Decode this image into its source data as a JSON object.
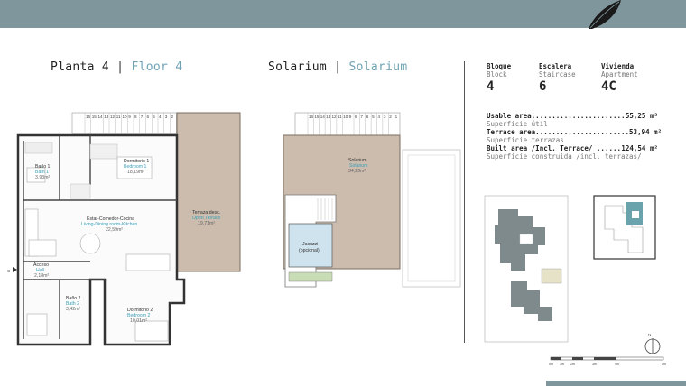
{
  "titles": {
    "left_es": "Planta 4",
    "left_en": "Floor 4",
    "right_es": "Solarium",
    "right_en": "Solarium",
    "sep": "|"
  },
  "info": {
    "bloque": {
      "label": "Bloque",
      "sub": "Block",
      "value": "4"
    },
    "escalera": {
      "label": "Escalera",
      "sub": "Staircase",
      "value": "6"
    },
    "vivienda": {
      "label": "Vivienda",
      "sub": "Apartment",
      "value": "4C"
    }
  },
  "areas": {
    "usable_label": "Usable area.......................",
    "usable_value": "55,25 m²",
    "usable_sub": "Superficie útil",
    "terrace_label": "Terrace area.......................",
    "terrace_value": "53,94 m²",
    "terrace_sub": "Superficie terrazas",
    "built_label": "Built area /Incl. Terrace/ ......",
    "built_value": "124,54 m²",
    "built_sub": "Superficie construida /incl. terrazas/"
  },
  "rooms": {
    "bano1": {
      "es": "Baño 1",
      "en": "Bath 1",
      "area": "3,93m²"
    },
    "dormitorio1": {
      "es": "Dormitorio 1",
      "en": "Bedroom 1",
      "area": "18,19m²"
    },
    "terraza": {
      "es": "Terraza desc.",
      "en": "Open Terrace",
      "area": "19,71m²"
    },
    "estar": {
      "es": "Estar-Comedor-Cocina",
      "en": "Living-Dining room-Kitchen",
      "area": "22,59m²"
    },
    "acceso": {
      "es": "Acceso",
      "en": "Hall",
      "area": "2,18m²"
    },
    "bano2": {
      "es": "Baño 2",
      "en": "Bath 2",
      "area": "3,42m²"
    },
    "dormitorio2": {
      "es": "Dormitorio 2",
      "en": "Bedroom 2",
      "area": "10,01m²"
    },
    "solarium": {
      "es": "Solarium",
      "en": "Solarium",
      "area": "34,23m²"
    },
    "jacuzzi": {
      "es": "Jacuzzi",
      "en": "(opcional)"
    }
  },
  "stairs_left": [
    "16",
    "15",
    "14",
    "13",
    "12",
    "11",
    "10",
    "9",
    "8",
    "7",
    "6",
    "5",
    "4",
    "3",
    "2",
    "1"
  ],
  "stairs_right": [
    "16",
    "15",
    "14",
    "13",
    "12",
    "11",
    "10",
    "9",
    "8",
    "7",
    "6",
    "5",
    "4",
    "3",
    "2",
    "1"
  ],
  "compass": "N",
  "scale": [
    "0m",
    "1m",
    "2m",
    "3m",
    "4m",
    "5m"
  ],
  "entry_mark": "C",
  "colors": {
    "band": "#7f969c",
    "accent": "#6fa3b3",
    "terrace": "#c9b8a7",
    "highlight": "#6aa3ab"
  }
}
